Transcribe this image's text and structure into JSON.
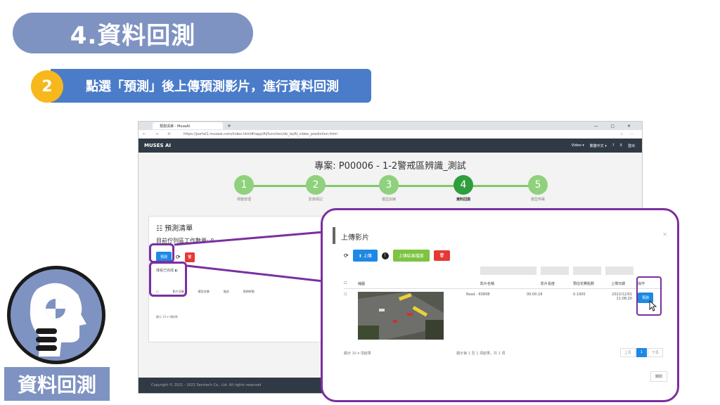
{
  "slide": {
    "title": "4.資料回測",
    "step_number": "2",
    "step_text": "點選「預測」後上傳預測影片，進行資料回測",
    "badge_label": "資料回測"
  },
  "browser": {
    "tab_title": "預測清單 - MuseAI",
    "url": "https://portal1.museai.com/index.html#/app/AI/function/ob_ta/AI_video_prediction.html",
    "app_logo": "MUSES AI",
    "app_menu": [
      "Video ▾",
      "繁體中文 ▾",
      "?",
      "X",
      "登出"
    ],
    "footer": "Copyright © 2021 - 2022 Servtech Co., Ltd. All rights reserved"
  },
  "project": {
    "title": "專案: P00006 - 1-2警戒區辨識_測試",
    "steps": [
      {
        "num": "1",
        "label": "標籤管理"
      },
      {
        "num": "2",
        "label": "影像標記"
      },
      {
        "num": "3",
        "label": "模型訓練"
      },
      {
        "num": "4",
        "label": "資料回測"
      },
      {
        "num": "5",
        "label": "模型佈署"
      }
    ]
  },
  "prediction_list": {
    "heading": "預測清單",
    "work_count": "目前佇列區工作數量: 0",
    "predict_btn": "預測",
    "filter_label": "僅看已完成",
    "columns": [
      "影片名稱",
      "模型名稱",
      "描述",
      "預測時間"
    ],
    "page_size_prefix": "顯示",
    "page_size": "10",
    "page_size_suffix": "項結果"
  },
  "upload_modal": {
    "title": "上傳影片",
    "upload_btn": "上傳",
    "upload_results_btn": "上傳結果檔案",
    "columns": [
      "縮圖",
      "影片名稱",
      "影片長度",
      "預估花費點數",
      "上傳日期",
      "操作"
    ],
    "row": {
      "video_name": "Road - 65808",
      "length": "00:00:18",
      "cost": "0.1000",
      "upload_date": "2022/12/01 11:08:20",
      "action": "預測"
    },
    "page_size_prefix": "顯示",
    "page_size": "10",
    "page_size_suffix": "項結果",
    "page_info": "顯示第 1 至 1 項結果，共 1 項",
    "pager": [
      "上頁",
      "1",
      "下頁"
    ],
    "close_btn": "關閉"
  },
  "colors": {
    "title_pill": "#7f93c2",
    "step_bar": "#4a7cc9",
    "step_circle": "#f6b81a",
    "highlight": "#7a2fa0",
    "primary_btn": "#1e88e5",
    "step_done": "#8fd17c",
    "step_active": "#2f9e3d"
  }
}
